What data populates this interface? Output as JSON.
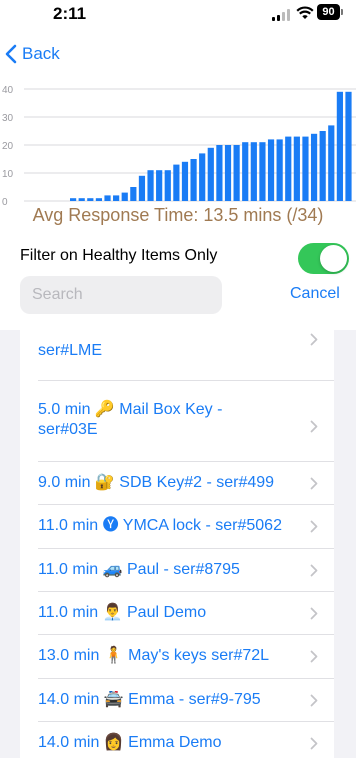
{
  "status_bar": {
    "time": "2:11",
    "battery": "90"
  },
  "nav": {
    "back_label": "Back"
  },
  "chart_data": {
    "type": "bar",
    "yticks": [
      0,
      10,
      20,
      30,
      40
    ],
    "ylim": [
      0,
      40
    ],
    "grid": true,
    "bar_color": "#1a7cf5",
    "values": [
      1,
      1,
      1,
      1,
      2,
      2,
      3,
      5,
      9,
      11,
      11,
      11,
      13,
      14,
      15,
      17,
      19,
      20,
      20,
      20,
      21,
      21,
      21,
      22,
      22,
      23,
      23,
      23,
      24,
      25,
      27,
      39,
      39
    ]
  },
  "summary": {
    "avg_text": "Avg Response Time: 13.5 mins (/34)"
  },
  "filter": {
    "label": "Filter on Healthy Items Only",
    "enabled": true
  },
  "search": {
    "placeholder": "Search",
    "value": "",
    "cancel_label": "Cancel"
  },
  "list": {
    "items": [
      {
        "line1": "ser#LME",
        "icon": "",
        "partial": true
      },
      {
        "line1": "5.0 min 🔑 Mail Box Key -",
        "line2": "ser#03E",
        "icon": "key-icon"
      },
      {
        "line1": "9.0 min 🔐 SDB Key#2 - ser#499",
        "icon": "locked-with-key-icon"
      },
      {
        "line1": "11.0 min 🅨 YMCA lock - ser#5062",
        "icon": "y-badge-icon"
      },
      {
        "line1": "11.0 min 🚙 Paul - ser#8795",
        "icon": "car-icon"
      },
      {
        "line1": "11.0 min 👨‍💼 Paul Demo",
        "icon": "man-icon"
      },
      {
        "line1": "13.0 min 🧍 May's keys ser#72L",
        "icon": "person-standing-icon"
      },
      {
        "line1": "14.0 min 🚔 Emma - ser#9-795",
        "icon": "police-car-icon"
      },
      {
        "line1": "14.0 min 👩 Emma Demo",
        "icon": "woman-icon"
      }
    ]
  },
  "colors": {
    "accent": "#1a7cf5",
    "toggle_on": "#34c759",
    "avg_text": "#a07a52",
    "list_bg": "#f2f2f6"
  }
}
